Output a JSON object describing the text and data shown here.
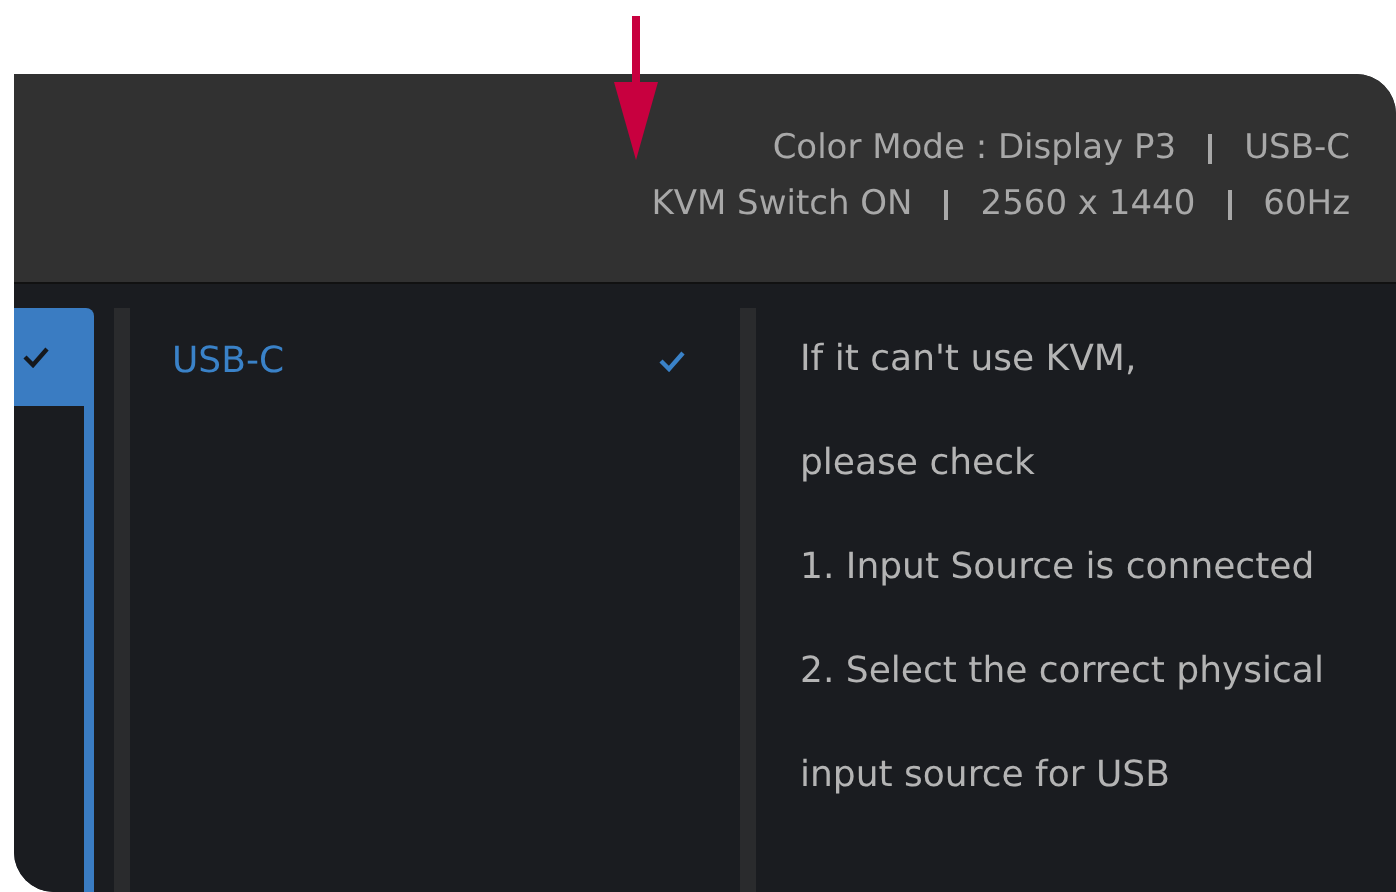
{
  "header": {
    "lines": [
      [
        "Color Mode : Display P3",
        "USB-C"
      ],
      [
        "KVM Switch ON",
        "2560 x 1440",
        "60Hz"
      ]
    ]
  },
  "menu": {
    "items": [
      {
        "selected": true,
        "checked": true
      }
    ]
  },
  "options": [
    {
      "label": "USB-C",
      "selected": true
    }
  ],
  "help": [
    "If it can't use KVM,",
    "please check",
    "1. Input Source is connected",
    "2. Select the correct physical",
    "input source for USB"
  ]
}
